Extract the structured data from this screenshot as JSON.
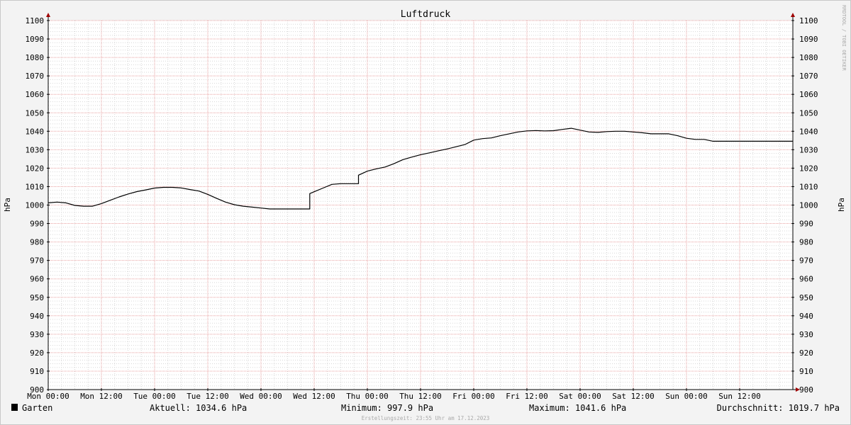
{
  "chart_data": {
    "type": "line",
    "title": "Luftdruck",
    "ylabel_left": "hPa",
    "ylabel_right": "hPa",
    "ylim": [
      900,
      1100
    ],
    "y_ticks": [
      900,
      910,
      920,
      930,
      940,
      950,
      960,
      970,
      980,
      990,
      1000,
      1010,
      1020,
      1030,
      1040,
      1050,
      1060,
      1070,
      1080,
      1090,
      1100
    ],
    "x_ticks": [
      "Mon 00:00",
      "Mon 12:00",
      "Tue 00:00",
      "Tue 12:00",
      "Wed 00:00",
      "Wed 12:00",
      "Thu 00:00",
      "Thu 12:00",
      "Fri 00:00",
      "Fri 12:00",
      "Sat 00:00",
      "Sat 12:00",
      "Sun 00:00",
      "Sun 12:00"
    ],
    "x_range_hours": [
      0,
      168
    ],
    "grid": true,
    "series": [
      {
        "name": "Garten",
        "color": "#000000",
        "x_hours": [
          0,
          2,
          4,
          6,
          8,
          10,
          12,
          14,
          16,
          18,
          20,
          22,
          24,
          26,
          28,
          30,
          32,
          34,
          36,
          38,
          40,
          42,
          44,
          46,
          48,
          50,
          52,
          54,
          56,
          58,
          59,
          59,
          60,
          62,
          64,
          66,
          68,
          70,
          70,
          72,
          74,
          76,
          78,
          80,
          82,
          84,
          86,
          88,
          90,
          92,
          94,
          96,
          98,
          100,
          102,
          104,
          106,
          108,
          110,
          112,
          114,
          116,
          118,
          120,
          122,
          124,
          126,
          128,
          130,
          132,
          134,
          136,
          138,
          140,
          142,
          144,
          146,
          148,
          150,
          152,
          154,
          156,
          158,
          160,
          162,
          164,
          166,
          168
        ],
        "values": [
          1001.2,
          1001.6,
          1001.2,
          999.8,
          999.4,
          999.4,
          1000.8,
          1002.6,
          1004.4,
          1006.0,
          1007.3,
          1008.2,
          1009.2,
          1009.6,
          1009.6,
          1009.3,
          1008.4,
          1007.6,
          1005.8,
          1003.6,
          1001.6,
          1000.2,
          999.4,
          998.9,
          998.4,
          997.9,
          997.9,
          997.9,
          997.9,
          997.9,
          997.9,
          1006.2,
          1007.2,
          1009.2,
          1011.2,
          1011.6,
          1011.6,
          1011.6,
          1016.2,
          1018.4,
          1019.6,
          1020.6,
          1022.4,
          1024.6,
          1026.0,
          1027.3,
          1028.3,
          1029.4,
          1030.4,
          1031.6,
          1032.8,
          1035.2,
          1036.0,
          1036.4,
          1037.6,
          1038.6,
          1039.6,
          1040.2,
          1040.4,
          1040.2,
          1040.3,
          1041.0,
          1041.6,
          1040.6,
          1039.6,
          1039.4,
          1039.8,
          1040.0,
          1040.0,
          1039.6,
          1039.2,
          1038.6,
          1038.6,
          1038.6,
          1037.6,
          1036.2,
          1035.6,
          1035.6,
          1034.6,
          1034.6,
          1034.6,
          1034.6,
          1034.6,
          1034.6,
          1034.6,
          1034.6,
          1034.6,
          1034.6
        ]
      }
    ]
  },
  "legend": {
    "name": "Garten",
    "swatch_color": "#000000",
    "current": "Aktuell: 1034.6 hPa",
    "minimum": "Minimum: 997.9 hPa",
    "maximum": "Maximum: 1041.6 hPa",
    "average": "Durchschnitt: 1019.7 hPa"
  },
  "footer": "Erstellungszeit: 23:55 Uhr am 17.12.2023",
  "watermark": "RRDTOOL / TOBI OETIKER",
  "colors": {
    "background": "#f3f3f3",
    "plot_background": "#ffffff",
    "major_grid": "#e8a0a0",
    "minor_grid": "#d8d8d8",
    "axis_arrow": "#a00000",
    "line": "#000000"
  }
}
